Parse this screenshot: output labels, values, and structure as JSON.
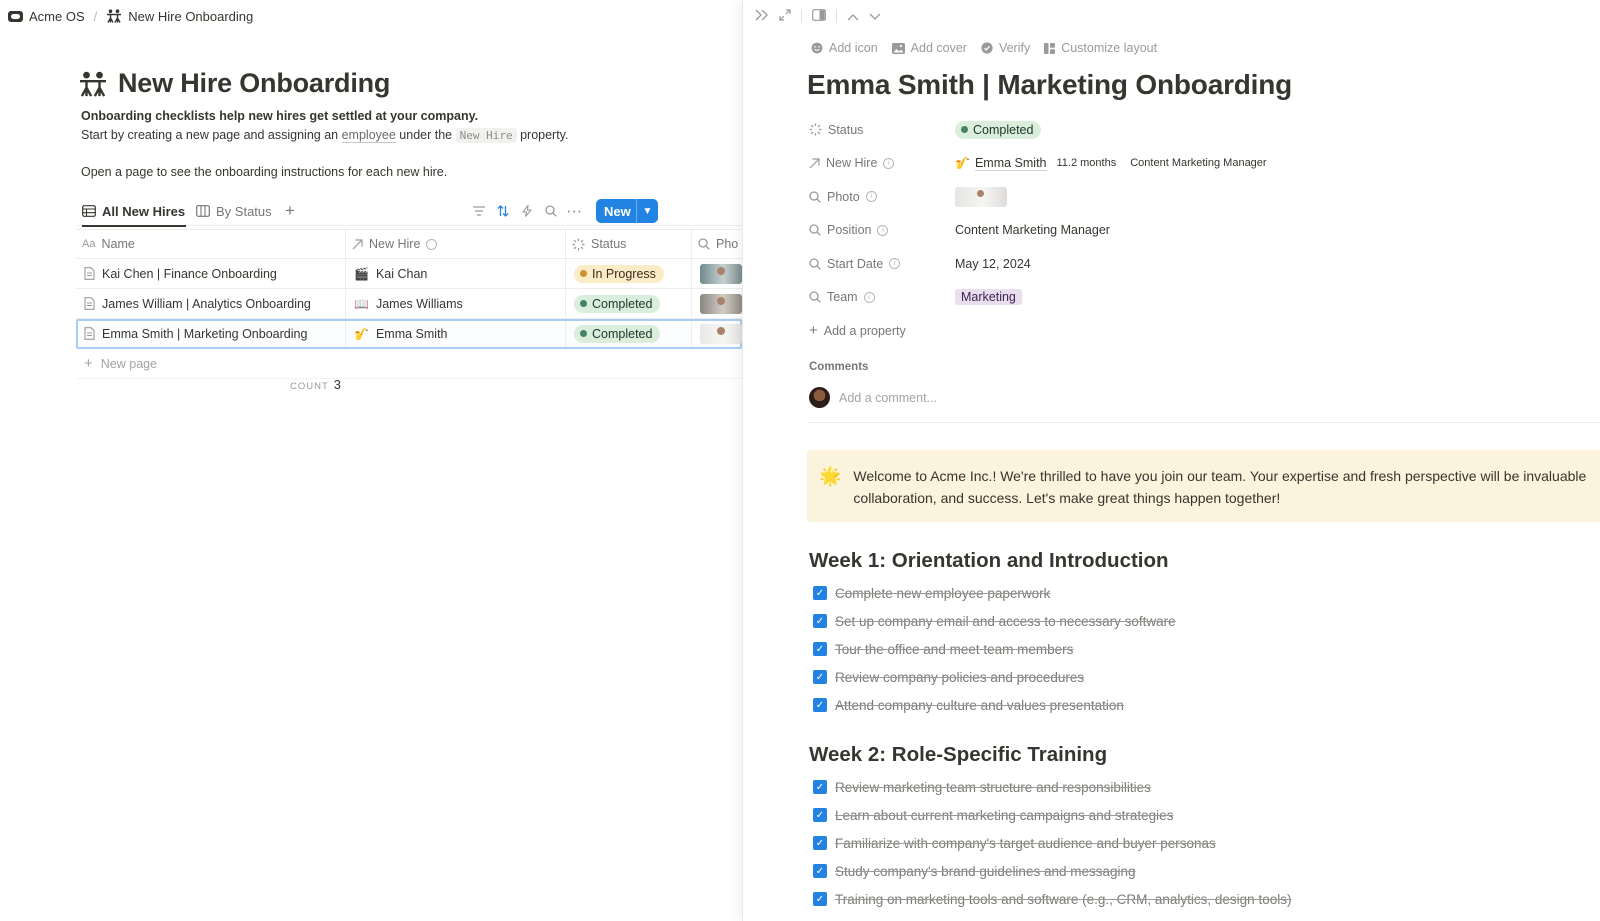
{
  "breadcrumb": {
    "workspace": "Acme OS",
    "page": "New Hire Onboarding"
  },
  "database": {
    "title": "New Hire Onboarding",
    "desc_line1": "Onboarding checklists help new hires get settled at your company.",
    "desc_line2_a": "Start by creating a new page and assigning an",
    "desc_line2_link": "employee",
    "desc_line2_b": "under the",
    "desc_line2_code": "New Hire",
    "desc_line2_c": "property.",
    "desc_line3": "Open a page to see the onboarding instructions for each new hire.",
    "views": {
      "all": "All New Hires",
      "by_status": "By Status"
    },
    "new_button": "New",
    "columns": {
      "name": "Name",
      "name_prefix": "Aa",
      "new_hire": "New Hire",
      "status": "Status",
      "photo": "Pho"
    },
    "rows": [
      {
        "name": "Kai Chen | Finance Onboarding",
        "hire_emoji": "🎬",
        "hire": "Kai Chan",
        "status": "In Progress"
      },
      {
        "name": "James William | Analytics Onboarding",
        "hire_emoji": "📖",
        "hire": "James Williams",
        "status": "Completed"
      },
      {
        "name": "Emma Smith | Marketing Onboarding",
        "hire_emoji": "🎷",
        "hire": "Emma Smith",
        "status": "Completed"
      }
    ],
    "new_page": "New page",
    "count_label": "COUNT",
    "count_value": "3"
  },
  "peek": {
    "actions": {
      "add_icon": "Add icon",
      "add_cover": "Add cover",
      "verify": "Verify",
      "customize": "Customize layout"
    },
    "title": "Emma Smith | Marketing Onboarding",
    "props": {
      "status_label": "Status",
      "status_value": "Completed",
      "new_hire_label": "New Hire",
      "new_hire_emoji": "🎷",
      "new_hire_name": "Emma Smith",
      "new_hire_tenure": "11.2 months",
      "new_hire_role": "Content Marketing Manager",
      "photo_label": "Photo",
      "position_label": "Position",
      "position_value": "Content Marketing Manager",
      "start_label": "Start Date",
      "start_value": "May 12, 2024",
      "team_label": "Team",
      "team_value": "Marketing",
      "add_property": "Add a property"
    },
    "comments_heading": "Comments",
    "comment_placeholder": "Add a comment...",
    "callout_icon": "🌟",
    "callout_line1": "Welcome to Acme Inc.! We're thrilled to have you join our team. Your expertise and fresh perspective will be invaluable",
    "callout_line2": "collaboration, and success. Let's make great things happen together!",
    "week1": {
      "heading": "Week 1: Orientation and Introduction",
      "items": [
        "Complete new employee paperwork",
        "Set up company email and access to necessary software",
        "Tour the office and meet team members",
        "Review company policies and procedures",
        "Attend company culture and values presentation"
      ]
    },
    "week2": {
      "heading": "Week 2: Role-Specific Training",
      "items": [
        "Review marketing team structure and responsibilities",
        "Learn about current marketing campaigns and strategies",
        "Familiarize with company's target audience and buyer personas",
        "Study company's brand guidelines and messaging",
        "Training on marketing tools and software (e.g., CRM, analytics, design tools)"
      ]
    }
  }
}
